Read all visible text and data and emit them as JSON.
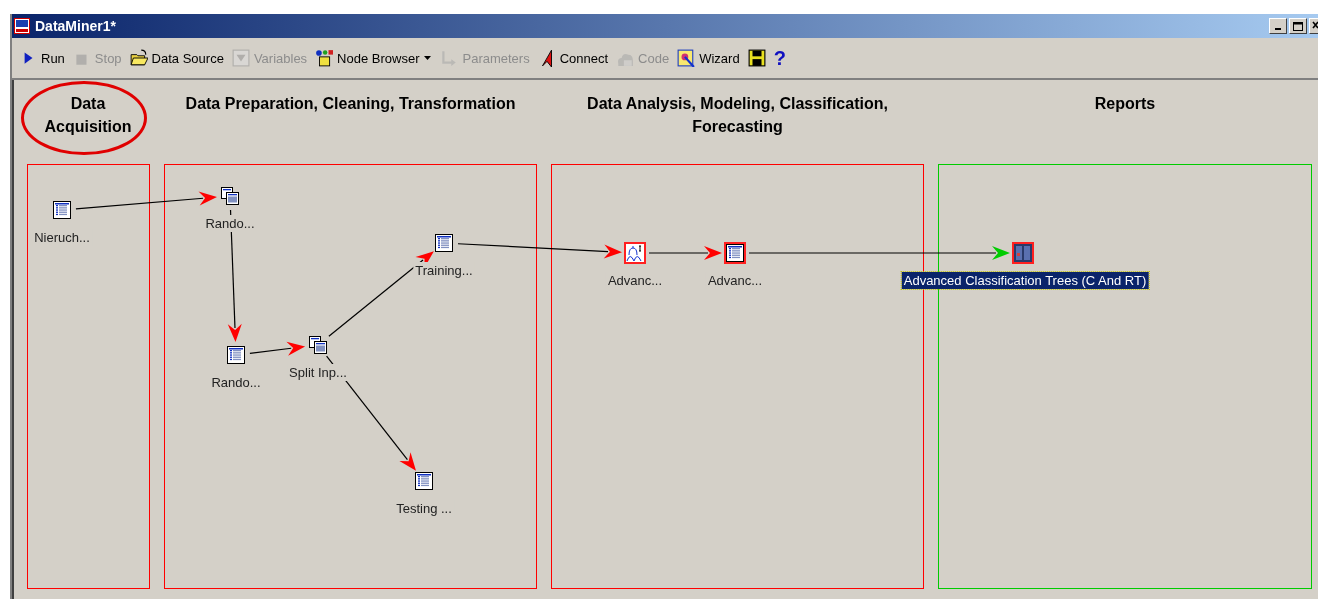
{
  "window": {
    "title": "DataMiner1*"
  },
  "toolbar": [
    {
      "label": "Run",
      "disabled": false
    },
    {
      "label": "Stop",
      "disabled": true
    },
    {
      "label": "Data Source",
      "disabled": false
    },
    {
      "label": "Variables",
      "disabled": true
    },
    {
      "label": "Node Browser",
      "disabled": false,
      "dropdown": true
    },
    {
      "label": "Parameters",
      "disabled": true
    },
    {
      "label": "Connect",
      "disabled": false
    },
    {
      "label": "Code",
      "disabled": true
    },
    {
      "label": "Wizard",
      "disabled": false
    },
    {
      "disabled": false
    },
    {
      "label": "?",
      "disabled": false
    }
  ],
  "sections": [
    {
      "heading": "Data Acquisition",
      "color": "#ff0000",
      "circled": true
    },
    {
      "heading": "Data Preparation, Cleaning, Transformation",
      "color": "#ff0000",
      "circled": false
    },
    {
      "heading": "Data Analysis, Modeling, Classification, Forecasting",
      "color": "#ff0000",
      "circled": false
    },
    {
      "heading": "Reports",
      "color": "#00cc00",
      "circled": false
    }
  ],
  "nodes": [
    {
      "label": "Nieruch...",
      "kind": "table",
      "marked": false,
      "selected": false
    },
    {
      "label": "Rando...",
      "kind": "multi",
      "marked": false,
      "selected": false
    },
    {
      "label": "Rando...",
      "kind": "table",
      "marked": false,
      "selected": false
    },
    {
      "label": "Split Inp...",
      "kind": "multi",
      "marked": false,
      "selected": false
    },
    {
      "label": "Training...",
      "kind": "table",
      "marked": false,
      "selected": false
    },
    {
      "label": "Testing ...",
      "kind": "table",
      "marked": false,
      "selected": false
    },
    {
      "label": "Advanc...",
      "kind": "tree",
      "marked": true,
      "selected": false
    },
    {
      "label": "Advanc...",
      "kind": "table",
      "marked": true,
      "selected": false
    },
    {
      "label": "Advanced Classification Trees (C And RT)",
      "kind": "report",
      "marked": true,
      "selected": true
    }
  ],
  "connections": [
    {
      "color": "#ff0000"
    },
    {
      "color": "#ff0000"
    },
    {
      "color": "#ff0000"
    },
    {
      "color": "#ff0000"
    },
    {
      "color": "#ff0000"
    },
    {
      "color": "#ff0000"
    },
    {
      "color": "#ff0000"
    },
    {
      "color": "#00cc00"
    }
  ]
}
